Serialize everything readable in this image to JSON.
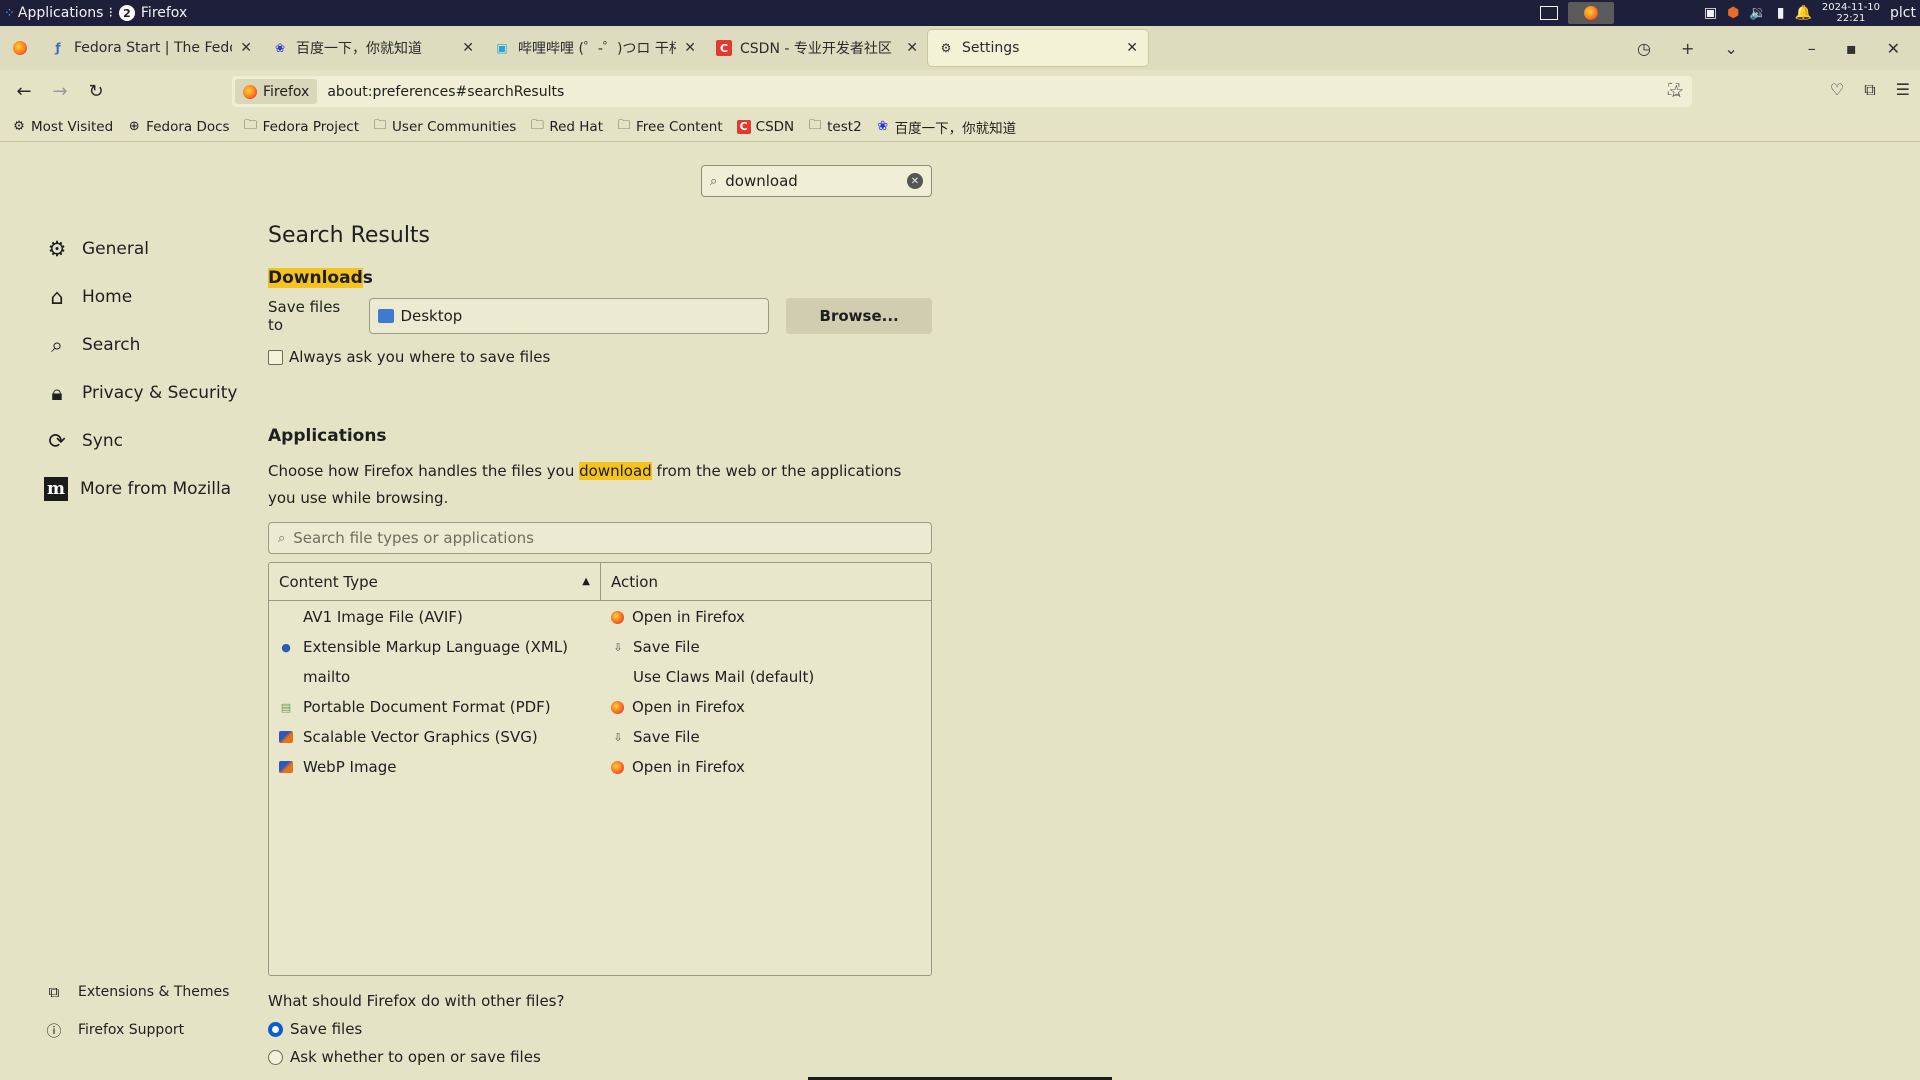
{
  "system_panel": {
    "apps_label": "Applications",
    "workspace_badge": "2",
    "active_window": "Firefox",
    "date": "2024-11-10",
    "time": "22:21",
    "user": "plct"
  },
  "tabs": [
    {
      "title": "Fedora Start | The Fedora",
      "icon": "fedora-icon"
    },
    {
      "title": "百度一下，你就知道",
      "icon": "baidu-icon"
    },
    {
      "title": "哔哩哔哩 (゜-゜)つロ 干杯~",
      "icon": "bilibili-icon"
    },
    {
      "title": "CSDN - 专业开发者社区",
      "icon": "csdn-icon"
    },
    {
      "title": "Settings",
      "icon": "gear-icon",
      "active": true
    }
  ],
  "urlbar": {
    "identity": "Firefox",
    "url": "about:preferences#searchResults"
  },
  "bookmarks": [
    {
      "label": "Most Visited",
      "icon": "gear-icon"
    },
    {
      "label": "Fedora Docs",
      "icon": "globe-icon"
    },
    {
      "label": "Fedora Project",
      "icon": "folder-icon"
    },
    {
      "label": "User Communities",
      "icon": "folder-icon"
    },
    {
      "label": "Red Hat",
      "icon": "folder-icon"
    },
    {
      "label": "Free Content",
      "icon": "folder-icon"
    },
    {
      "label": "CSDN",
      "icon": "csdn-icon"
    },
    {
      "label": "test2",
      "icon": "folder-icon"
    },
    {
      "label": "百度一下，你就知道",
      "icon": "baidu-icon"
    }
  ],
  "search": {
    "value": "download"
  },
  "sidebar": {
    "items": [
      {
        "label": "General",
        "icon": "gear-icon"
      },
      {
        "label": "Home",
        "icon": "home-icon"
      },
      {
        "label": "Search",
        "icon": "search-icon"
      },
      {
        "label": "Privacy & Security",
        "icon": "lock-icon"
      },
      {
        "label": "Sync",
        "icon": "sync-icon"
      },
      {
        "label": "More from Mozilla",
        "icon": "mozilla-icon"
      }
    ],
    "bottom": [
      {
        "label": "Extensions & Themes",
        "icon": "puzzle-icon"
      },
      {
        "label": "Firefox Support",
        "icon": "help-icon"
      }
    ]
  },
  "main": {
    "title": "Search Results",
    "downloads": {
      "title_highlight": "Download",
      "title_rest": "s",
      "save_label": "Save files to",
      "folder": "Desktop",
      "browse": "Browse...",
      "always_ask": "Always ask you where to save files"
    },
    "applications": {
      "title": "Applications",
      "desc_before": "Choose how Firefox handles the files you ",
      "desc_highlight": "download",
      "desc_after": " from the web or the applications you use while browsing.",
      "search_placeholder": "Search file types or applications",
      "col_content": "Content Type",
      "col_action": "Action",
      "rows": [
        {
          "type": "AV1 Image File (AVIF)",
          "action": "Open in Firefox",
          "type_icon": "",
          "action_icon": "firefox-icon"
        },
        {
          "type": "Extensible Markup Language (XML)",
          "action": "Save File",
          "type_icon": "xml-icon",
          "action_icon": "save-icon"
        },
        {
          "type": "mailto",
          "action": "Use Claws Mail (default)",
          "type_icon": "",
          "action_icon": ""
        },
        {
          "type": "Portable Document Format (PDF)",
          "action": "Open in Firefox",
          "type_icon": "pdf-icon",
          "action_icon": "firefox-icon"
        },
        {
          "type": "Scalable Vector Graphics (SVG)",
          "action": "Save File",
          "type_icon": "svg-icon",
          "action_icon": "save-icon"
        },
        {
          "type": "WebP Image",
          "action": "Open in Firefox",
          "type_icon": "svg-icon",
          "action_icon": "firefox-icon"
        }
      ]
    },
    "other_files": {
      "question": "What should Firefox do with other files?",
      "options": [
        {
          "label": "Save files",
          "selected": true
        },
        {
          "label": "Ask whether to open or save files",
          "selected": false
        }
      ]
    }
  }
}
